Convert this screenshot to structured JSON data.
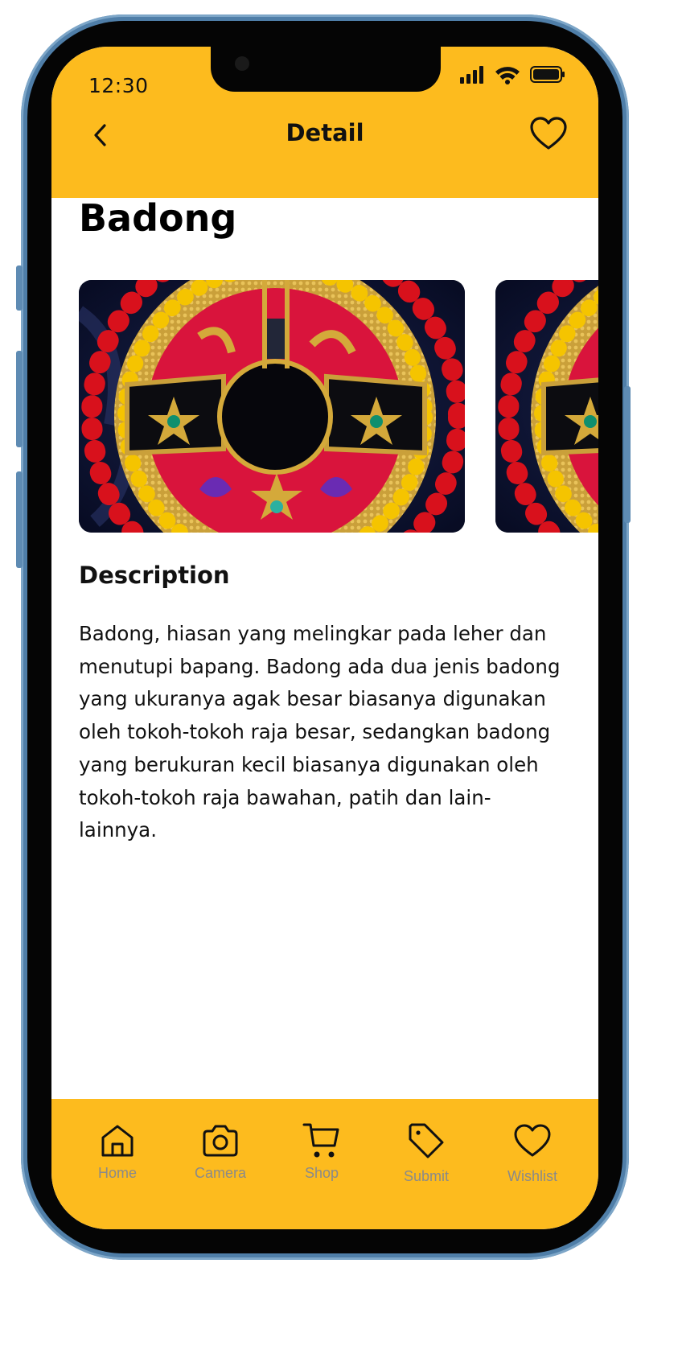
{
  "status_bar": {
    "time": "12:30"
  },
  "header": {
    "title": "Detail"
  },
  "item": {
    "title": "Badong",
    "section_heading": "Description",
    "description": "Badong, hiasan yang melingkar pada leher dan menutupi bapang. Badong ada dua jenis badong yang ukuranya agak besar biasanya digunakan oleh tokoh-tokoh raja besar, sedangkan badong yang berukuran kecil biasanya digunakan oleh tokoh-tokoh raja bawahan, patih dan lain-lainnya."
  },
  "tabs": [
    {
      "label": "Home",
      "icon": "home-icon"
    },
    {
      "label": "Camera",
      "icon": "camera-icon"
    },
    {
      "label": "Shop",
      "icon": "cart-icon"
    },
    {
      "label": "Submit",
      "icon": "tag-icon"
    },
    {
      "label": "Wishlist",
      "icon": "heart-icon"
    }
  ],
  "colors": {
    "accent": "#FDBB1E",
    "text": "#111111",
    "tab_label": "#8a8a8a"
  }
}
